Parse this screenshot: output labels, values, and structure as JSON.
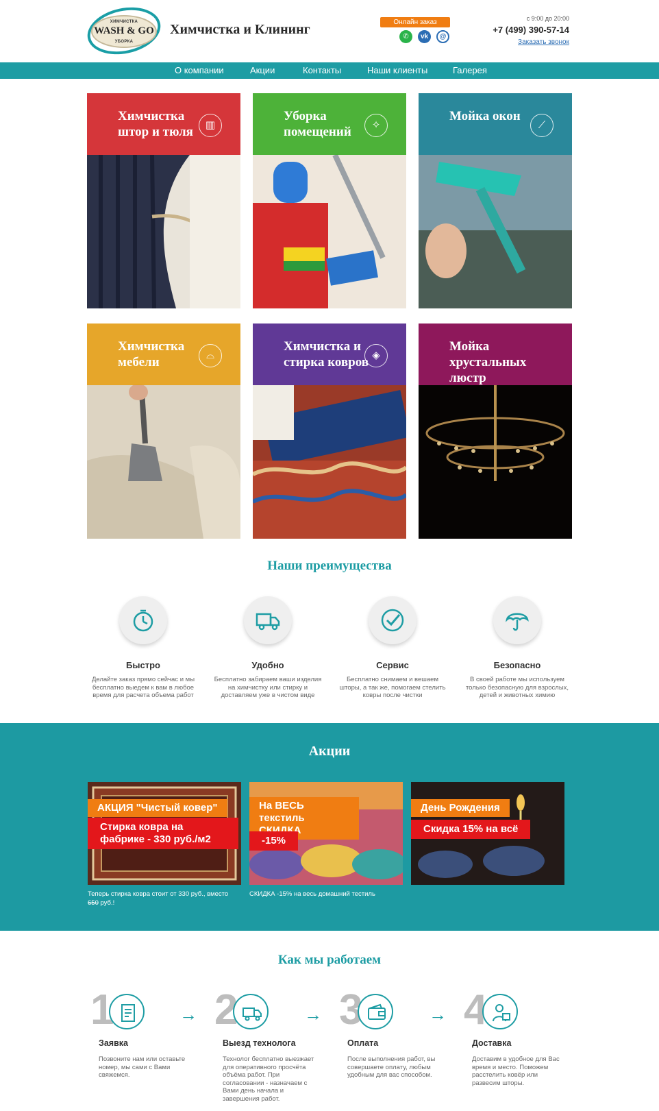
{
  "header": {
    "logo_top": "ХИМЧИСТКА",
    "logo_brand": "WASH & GO",
    "logo_bottom": "УБОРКА",
    "site_title": "Химчистка и Клининг",
    "online_order": "Онлайн заказ",
    "socials": [
      "whatsapp-icon",
      "vk-icon",
      "mail-icon"
    ],
    "hours": "с 9:00 до 20:00",
    "phone": "+7 (499) 390-57-14",
    "callback": "Заказать звонок"
  },
  "nav": [
    "О компании",
    "Акции",
    "Контакты",
    "Наши клиенты",
    "Галерея"
  ],
  "services": [
    {
      "title": "Химчистка штор и тюля",
      "l1": "Химчистка",
      "l2": "штор и тюля",
      "l3": "",
      "color": "#d2272c",
      "icon": "curtain-icon"
    },
    {
      "title": "Уборка помещений",
      "l1": "Уборка",
      "l2": "помещений",
      "l3": "",
      "color": "#3fae2a",
      "icon": "cleaning-icon"
    },
    {
      "title": "Мойка окон",
      "l1": "Мойка окон",
      "l2": "",
      "l3": "",
      "color": "#23879a",
      "icon": "squeegee-icon"
    },
    {
      "title": "Химчистка мебели",
      "l1": "Химчистка",
      "l2": "мебели",
      "l3": "",
      "color": "#e6a21d",
      "icon": "sofa-icon"
    },
    {
      "title": "Химчистка и стирка ковров",
      "l1": "Химчистка и",
      "l2": "стирка ковров",
      "l3": "",
      "color": "#5b3aa0",
      "icon": "carpet-icon"
    },
    {
      "title": "Мойка хрустальных люстр",
      "l1": "Мойка",
      "l2": "хрустальных",
      "l3": "люстр",
      "color": "#9a1a63",
      "icon": "chandelier-icon"
    }
  ],
  "advantages": {
    "title": "Наши преимущества",
    "items": [
      {
        "name": "Быстро",
        "desc": "Делайте заказ прямо сейчас и мы бесплатно выедем к вам в любое время для расчета объема работ",
        "icon": "stopwatch-icon"
      },
      {
        "name": "Удобно",
        "desc": "Бесплатно забираем ваши изделия на химчистку или стирку и доставляем уже в чистом виде",
        "icon": "truck-icon"
      },
      {
        "name": "Сервис",
        "desc": "Бесплатно снимаем и вешаем шторы, а так же, помогаем стелить ковры после чистки",
        "icon": "check-icon"
      },
      {
        "name": "Безопасно",
        "desc": "В своей работе мы используем только безопасную для взрослых, детей и животных химию",
        "icon": "umbrella-icon"
      }
    ]
  },
  "promos": {
    "title": "Акции",
    "items": [
      {
        "orange": "АКЦИЯ \"Чистый ковер\"",
        "red": "Стирка ковра на фабрике - 330 руб./м2",
        "caption_main": "Теперь стирка ковра стоит от 330 руб., вместо ",
        "caption_old": "650",
        "caption_end": " руб.!"
      },
      {
        "orange": "На ВЕСЬ текстиль СКИДКА",
        "red": "-15%",
        "caption_main": "СКИДКА -15% на весь домашний тестиль",
        "caption_old": "",
        "caption_end": ""
      },
      {
        "orange": "День Рождения",
        "red": "Скидка 15% на всё",
        "caption_main": "",
        "caption_old": "",
        "caption_end": ""
      }
    ]
  },
  "how": {
    "title": "Как мы работаем",
    "steps": [
      {
        "num": "1",
        "name": "Заявка",
        "desc": "Позвоните нам или оставьте номер, мы сами с Вами свяжемся.",
        "icon": "form-icon"
      },
      {
        "num": "2",
        "name": "Выезд технолога",
        "desc": "Технолог бесплатно выезжает для оперативного просчёта объёма работ. При согласовании - назначаем с Вами день начала и завершения работ.",
        "icon": "delivery-truck-icon"
      },
      {
        "num": "3",
        "name": "Оплата",
        "desc": "После выполнения работ, вы совершаете оплату, любым удобным для вас способом.",
        "icon": "wallet-icon"
      },
      {
        "num": "4",
        "name": "Доставка",
        "desc": "Доставим в удобное для Вас время и место. Поможем расстелить ковёр или развесим шторы.",
        "icon": "courier-icon"
      }
    ]
  }
}
